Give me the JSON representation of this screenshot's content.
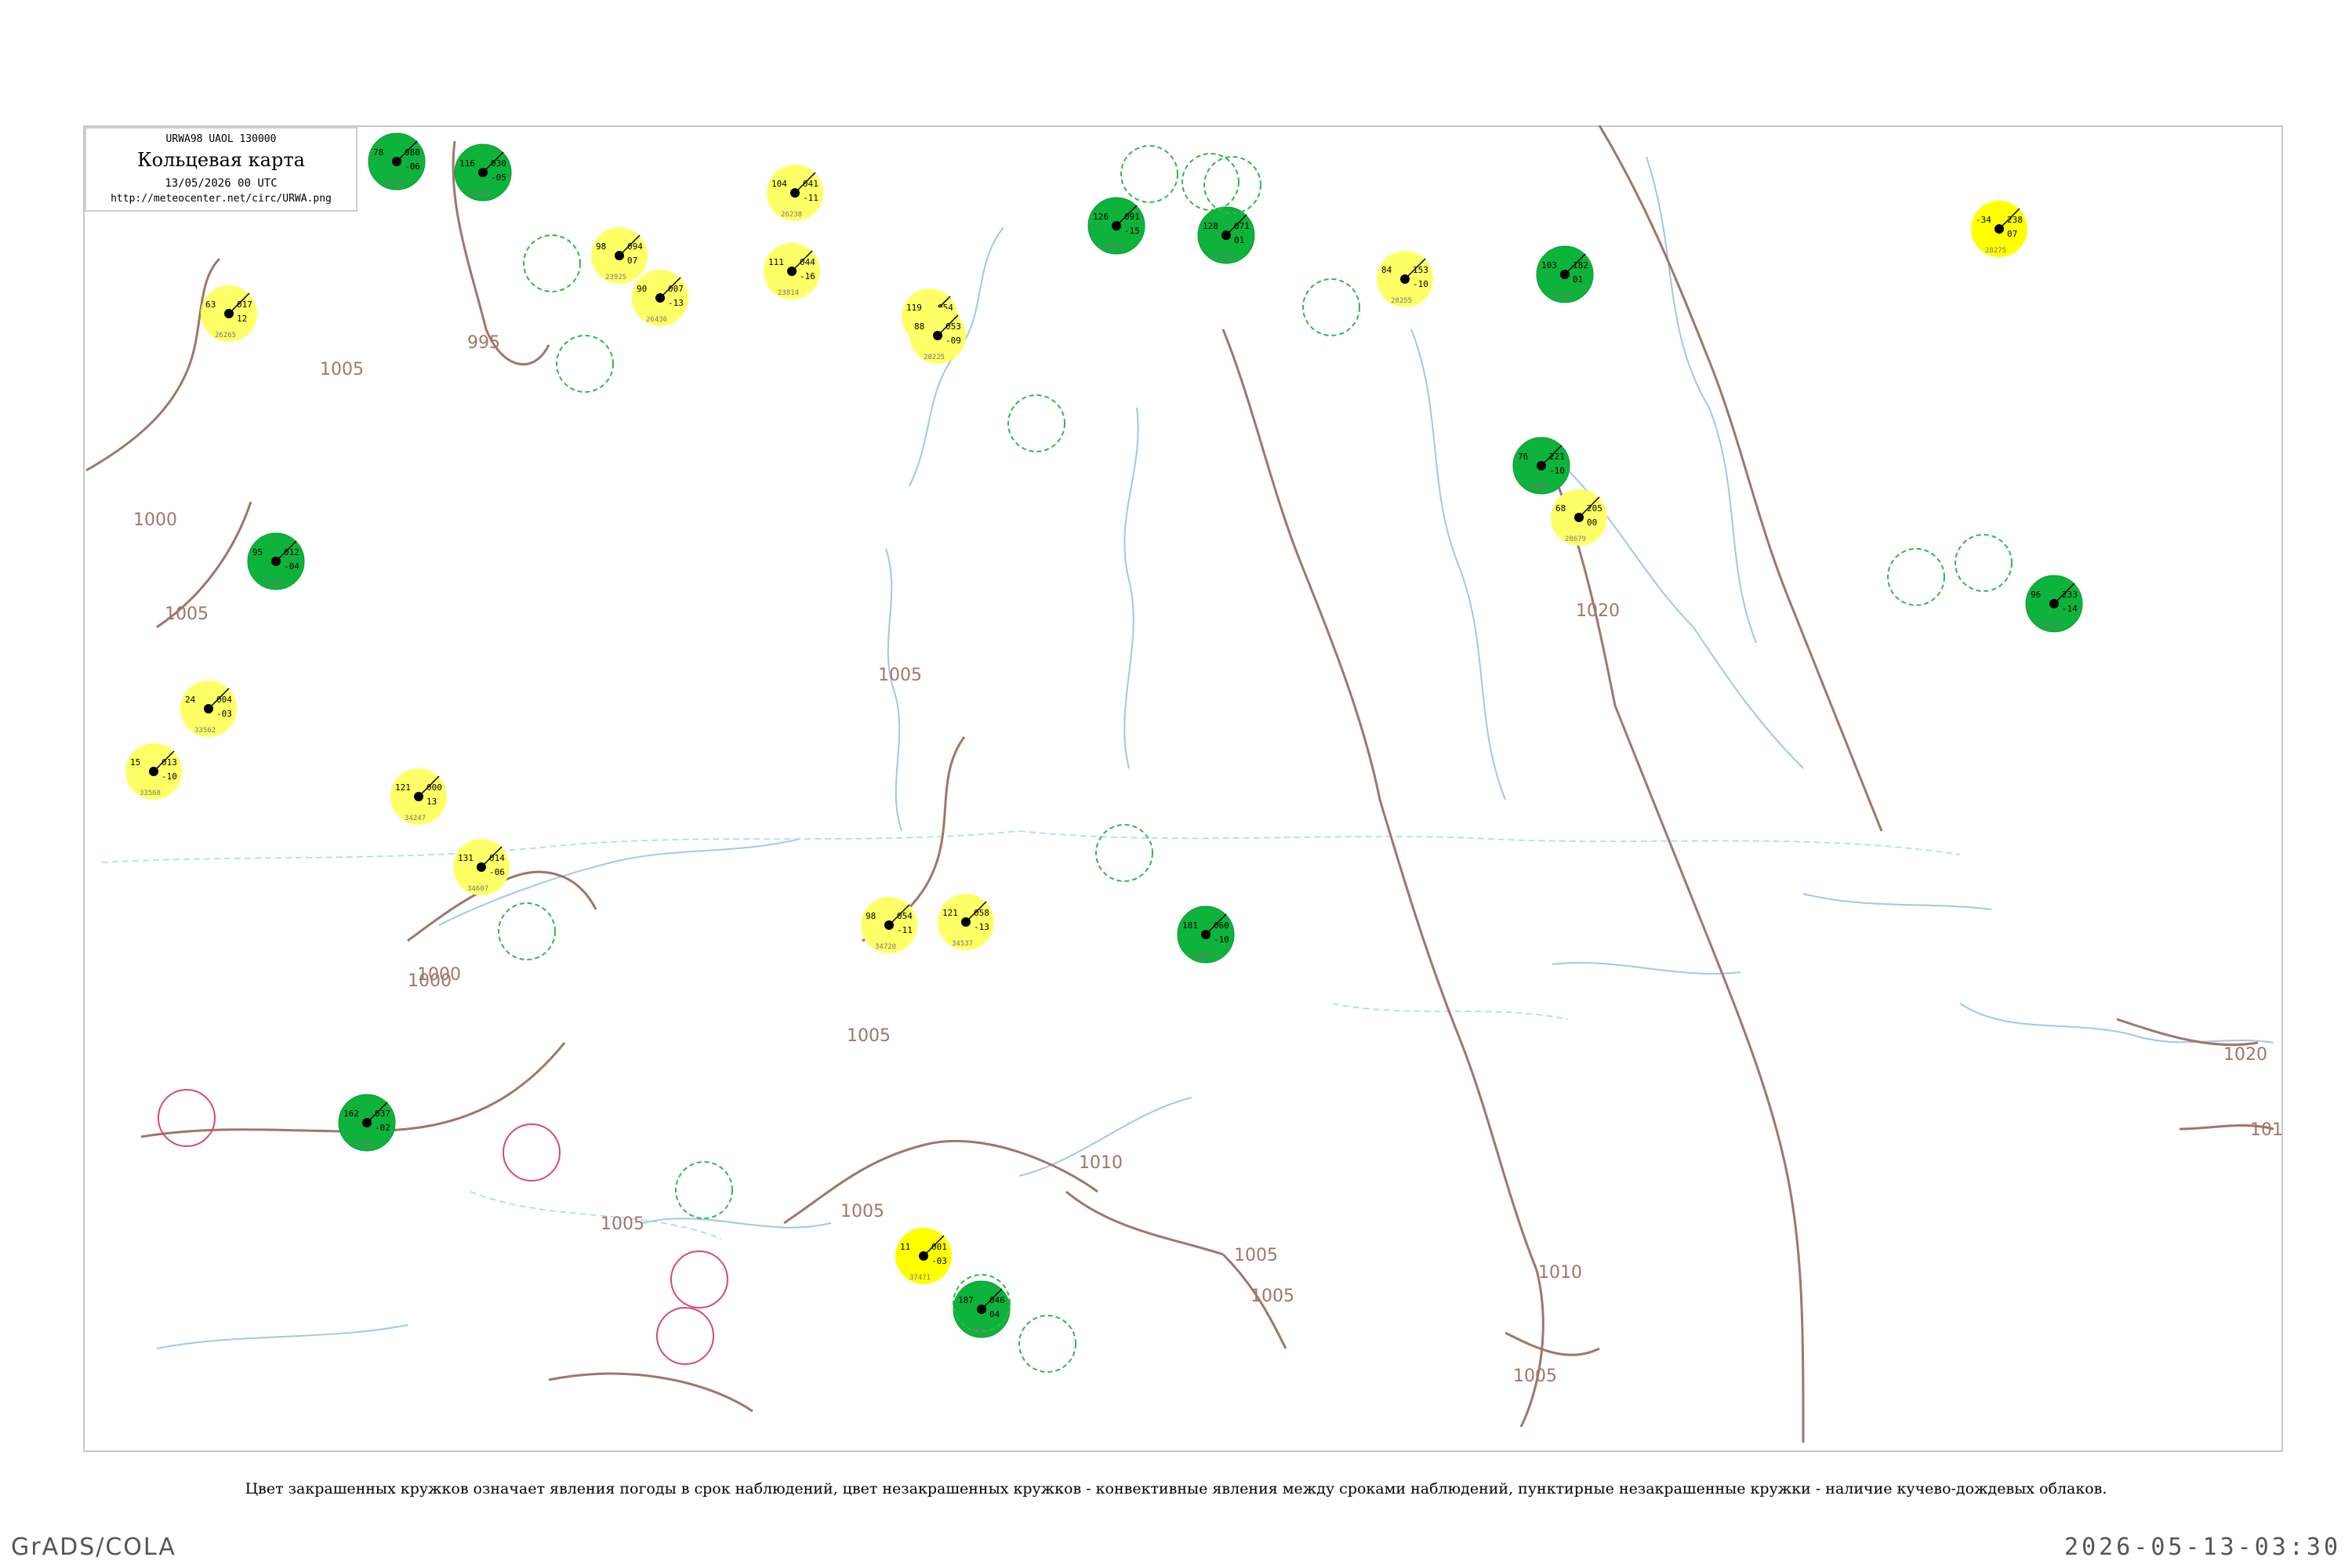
{
  "header": {
    "code_line": "URWA98  UAOL  130000",
    "title": "Кольцевая карта",
    "datetime": "13/05/2026 00 UTC",
    "url": "http://meteocenter.net/circ/URWA.png"
  },
  "caption": "Цвет закрашенных кружков означает явления погоды в срок наблюдений, цвет незакрашенных кружков - конвективные явления между сроками наблюдений, пунктирные незакрашенные кружки - наличие кучево-дождевых облаков.",
  "footer": {
    "left": "GrADS/COLA",
    "right": "2026-05-13-03:30"
  },
  "colors": {
    "isobar": "#a0766a",
    "river": "#9fc8ea",
    "precip_fill": "#0db33a",
    "fog_fill": "#ffff66",
    "strong_fill": "#ffff00",
    "cb_ring": "#2dba4a",
    "thunder_ring": "#d44a7a"
  },
  "isobar_labels": [
    {
      "text": "995"
    },
    {
      "text": "1005"
    },
    {
      "text": "1000"
    },
    {
      "text": "1005"
    },
    {
      "text": "1000"
    },
    {
      "text": "1005"
    },
    {
      "text": "1005"
    },
    {
      "text": "1005"
    },
    {
      "text": "1010"
    },
    {
      "text": "1005"
    },
    {
      "text": "1005"
    },
    {
      "text": "1005"
    },
    {
      "text": "1005"
    },
    {
      "text": "1010"
    },
    {
      "text": "1020"
    },
    {
      "text": "1020"
    },
    {
      "text": "101"
    },
    {
      "text": "1005"
    },
    {
      "text": "1000"
    }
  ],
  "stations": [
    {
      "type": "precip",
      "p": "980",
      "t": "78",
      "d": "-06",
      "idx": "26422"
    },
    {
      "type": "precip",
      "p": "030",
      "t": "116",
      "d": "-05",
      "idx": "26326"
    },
    {
      "type": "fog",
      "p": "094",
      "t": "98",
      "d": "07",
      "idx": "23925"
    },
    {
      "type": "fog",
      "p": "007",
      "t": "90",
      "d": "-13",
      "idx": "26436"
    },
    {
      "type": "fog",
      "p": "044",
      "t": "111",
      "d": "-16",
      "idx": "23814"
    },
    {
      "type": "fog",
      "p": "041",
      "t": "104",
      "d": "-11",
      "idx": "26238"
    },
    {
      "type": "fog",
      "p": "054",
      "t": "119",
      "d": "-05",
      "idx": "27612"
    },
    {
      "type": "fog",
      "p": "053",
      "t": "88",
      "d": "-09",
      "idx": "28225"
    },
    {
      "type": "precip",
      "p": "091",
      "t": "126",
      "d": "-15",
      "idx": "27037"
    },
    {
      "type": "precip",
      "p": "071",
      "t": "128",
      "d": "01",
      "idx": "27612"
    },
    {
      "type": "fog",
      "p": "153",
      "t": "84",
      "d": "-10",
      "idx": "28255"
    },
    {
      "type": "precip",
      "p": "182",
      "t": "103",
      "d": "01",
      "idx": "28722"
    },
    {
      "type": "strong",
      "p": "238",
      "t": "-34",
      "d": "07",
      "idx": "28275"
    },
    {
      "type": "fog",
      "p": "017",
      "t": "63",
      "d": "12",
      "idx": "26265"
    },
    {
      "type": "precip",
      "p": "012",
      "t": "95",
      "d": "-04",
      "idx": "33184"
    },
    {
      "type": "fog",
      "p": "004",
      "t": "24",
      "d": "-03",
      "idx": "33562"
    },
    {
      "type": "fog",
      "p": "013",
      "t": "15",
      "d": "-10",
      "idx": "33568"
    },
    {
      "type": "fog",
      "p": "000",
      "t": "121",
      "d": "13",
      "idx": "34247"
    },
    {
      "type": "fog",
      "p": "014",
      "t": "131",
      "d": "-06",
      "idx": "34607"
    },
    {
      "type": "fog",
      "p": "054",
      "t": "98",
      "d": "-11",
      "idx": "34720"
    },
    {
      "type": "fog",
      "p": "058",
      "t": "121",
      "d": "-13",
      "idx": "34537"
    },
    {
      "type": "precip",
      "p": "060",
      "t": "181",
      "d": "-10",
      "idx": "35067"
    },
    {
      "type": "strong",
      "p": "001",
      "t": "11",
      "d": "-03",
      "idx": "37471"
    },
    {
      "type": "precip",
      "p": "037",
      "t": "162",
      "d": "-02",
      "idx": "37050"
    },
    {
      "type": "precip",
      "p": "046",
      "t": "187",
      "d": "04",
      "idx": "37021"
    },
    {
      "type": "precip",
      "p": "221",
      "t": "76",
      "d": "-10",
      "idx": "36086"
    },
    {
      "type": "precip",
      "p": "233",
      "t": "96",
      "d": "-14",
      "idx": "34167"
    },
    {
      "type": "fog",
      "p": "205",
      "t": "68",
      "d": "00",
      "idx": "28679"
    }
  ]
}
